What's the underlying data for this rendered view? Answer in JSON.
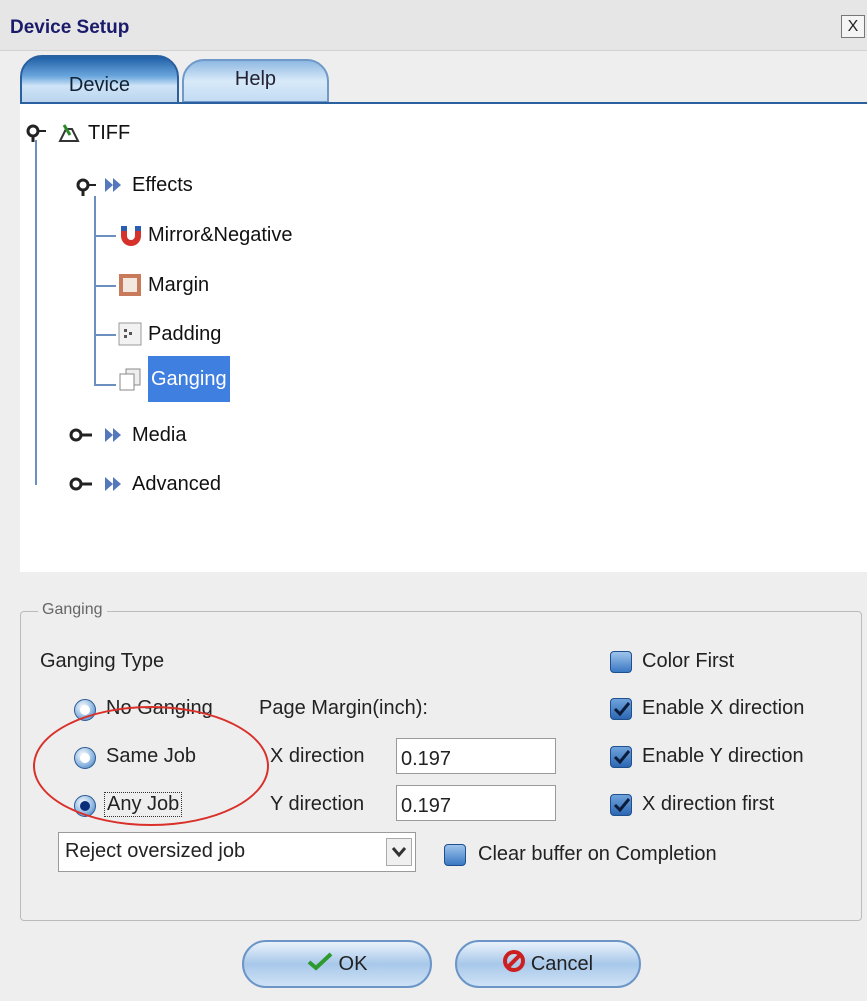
{
  "window": {
    "title": "Device Setup",
    "close_label": "X"
  },
  "tabs": [
    {
      "label": "Device",
      "active": true
    },
    {
      "label": "Help",
      "active": false
    }
  ],
  "tree": {
    "root": "TIFF",
    "effects": "Effects",
    "mirror": "Mirror&Negative",
    "margin": "Margin",
    "padding": "Padding",
    "ganging": "Ganging",
    "media": "Media",
    "advanced": "Advanced"
  },
  "panel": {
    "legend": "Ganging",
    "ganging_type_label": "Ganging Type",
    "radio_no": "No Ganging",
    "radio_same": "Same Job",
    "radio_any": "Any Job",
    "page_margin_label": "Page Margin(inch):",
    "x_label": "X direction",
    "x_value": "0.197",
    "y_label": "Y direction",
    "y_value": "0.197",
    "color_first": "Color First",
    "enable_x": "Enable X direction",
    "enable_y": "Enable Y direction",
    "x_first": "X direction first",
    "clear_buffer": "Clear buffer on Completion",
    "oversize_select": "Reject oversized job"
  },
  "buttons": {
    "ok": "OK",
    "cancel": "Cancel"
  }
}
